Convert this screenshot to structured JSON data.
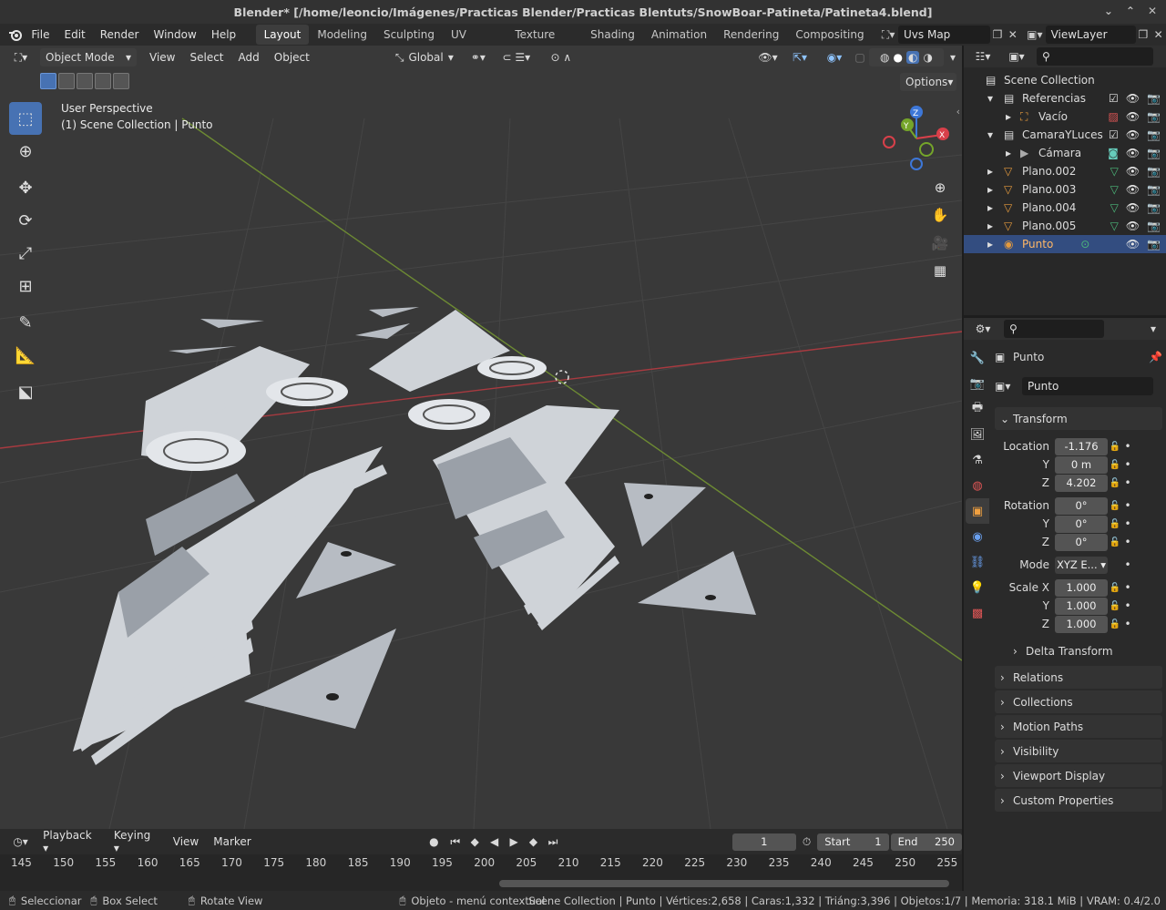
{
  "window": {
    "title": "Blender* [/home/leoncio/Imágenes/Practicas Blender/Practicas Blentuts/SnowBoar-Patineta/Patineta4.blend]"
  },
  "menu": [
    "File",
    "Edit",
    "Render",
    "Window",
    "Help"
  ],
  "workspaces": [
    "Layout",
    "Modeling",
    "Sculpting",
    "UV Editing",
    "Texture Paint",
    "Shading",
    "Animation",
    "Rendering",
    "Compositing"
  ],
  "scene_name": "Uvs Map",
  "view_layer": "ViewLayer",
  "viewport": {
    "mode": "Object Mode",
    "menus": [
      "View",
      "Select",
      "Add",
      "Object"
    ],
    "orientation": "Global",
    "options": "Options",
    "overlay_line1": "User Perspective",
    "overlay_line2": "(1) Scene Collection | Punto",
    "gizmo": {
      "x": "X",
      "y": "Y",
      "z": "Z"
    }
  },
  "outliner": {
    "root": "Scene Collection",
    "rows": [
      {
        "name": "Referencias"
      },
      {
        "name": "Vacío"
      },
      {
        "name": "CamaraYLuces"
      },
      {
        "name": "Cámara"
      },
      {
        "name": "Plano.002"
      },
      {
        "name": "Plano.003"
      },
      {
        "name": "Plano.004"
      },
      {
        "name": "Plano.005"
      },
      {
        "name": "Punto"
      }
    ]
  },
  "properties": {
    "object_name": "Punto",
    "datablock": "Punto",
    "transform": {
      "title": "Transform",
      "location_label": "Location",
      "location": [
        "-1.176",
        "0 m",
        "4.202"
      ],
      "rotation_label": "Rotation",
      "rotation": [
        "0°",
        "0°",
        "0°"
      ],
      "mode_label": "Mode",
      "mode": "XYZ E...",
      "scale_label": "Scale X",
      "scale": [
        "1.000",
        "1.000",
        "1.000"
      ],
      "y": "Y",
      "z": "Z",
      "delta": "Delta Transform"
    },
    "panels": [
      "Relations",
      "Collections",
      "Motion Paths",
      "Visibility",
      "Viewport Display",
      "Custom Properties"
    ]
  },
  "timeline": {
    "menus": [
      "Playback",
      "Keying",
      "View",
      "Marker"
    ],
    "current_frame": "1",
    "start_label": "Start",
    "start": "1",
    "end_label": "End",
    "end": "250",
    "ticks": [
      "145",
      "150",
      "155",
      "160",
      "165",
      "170",
      "175",
      "180",
      "185",
      "190",
      "195",
      "200",
      "205",
      "210",
      "215",
      "220",
      "225",
      "230",
      "235",
      "240",
      "245",
      "250",
      "255"
    ]
  },
  "status": {
    "select": "Seleccionar",
    "box": "Box Select",
    "rotate": "Rotate View",
    "context": "Objeto - menú contextual",
    "stats": "Scene Collection | Punto | Vértices:2,658 | Caras:1,332 | Triáng:3,396 | Objetos:1/7 | Memoria: 318.1 MiB | VRAM: 0.4/2.0"
  },
  "colors": {
    "accent": "#4772b3",
    "x_axis": "#c8353d",
    "y_axis": "#7ea43a",
    "selected_text": "#ffb766"
  }
}
